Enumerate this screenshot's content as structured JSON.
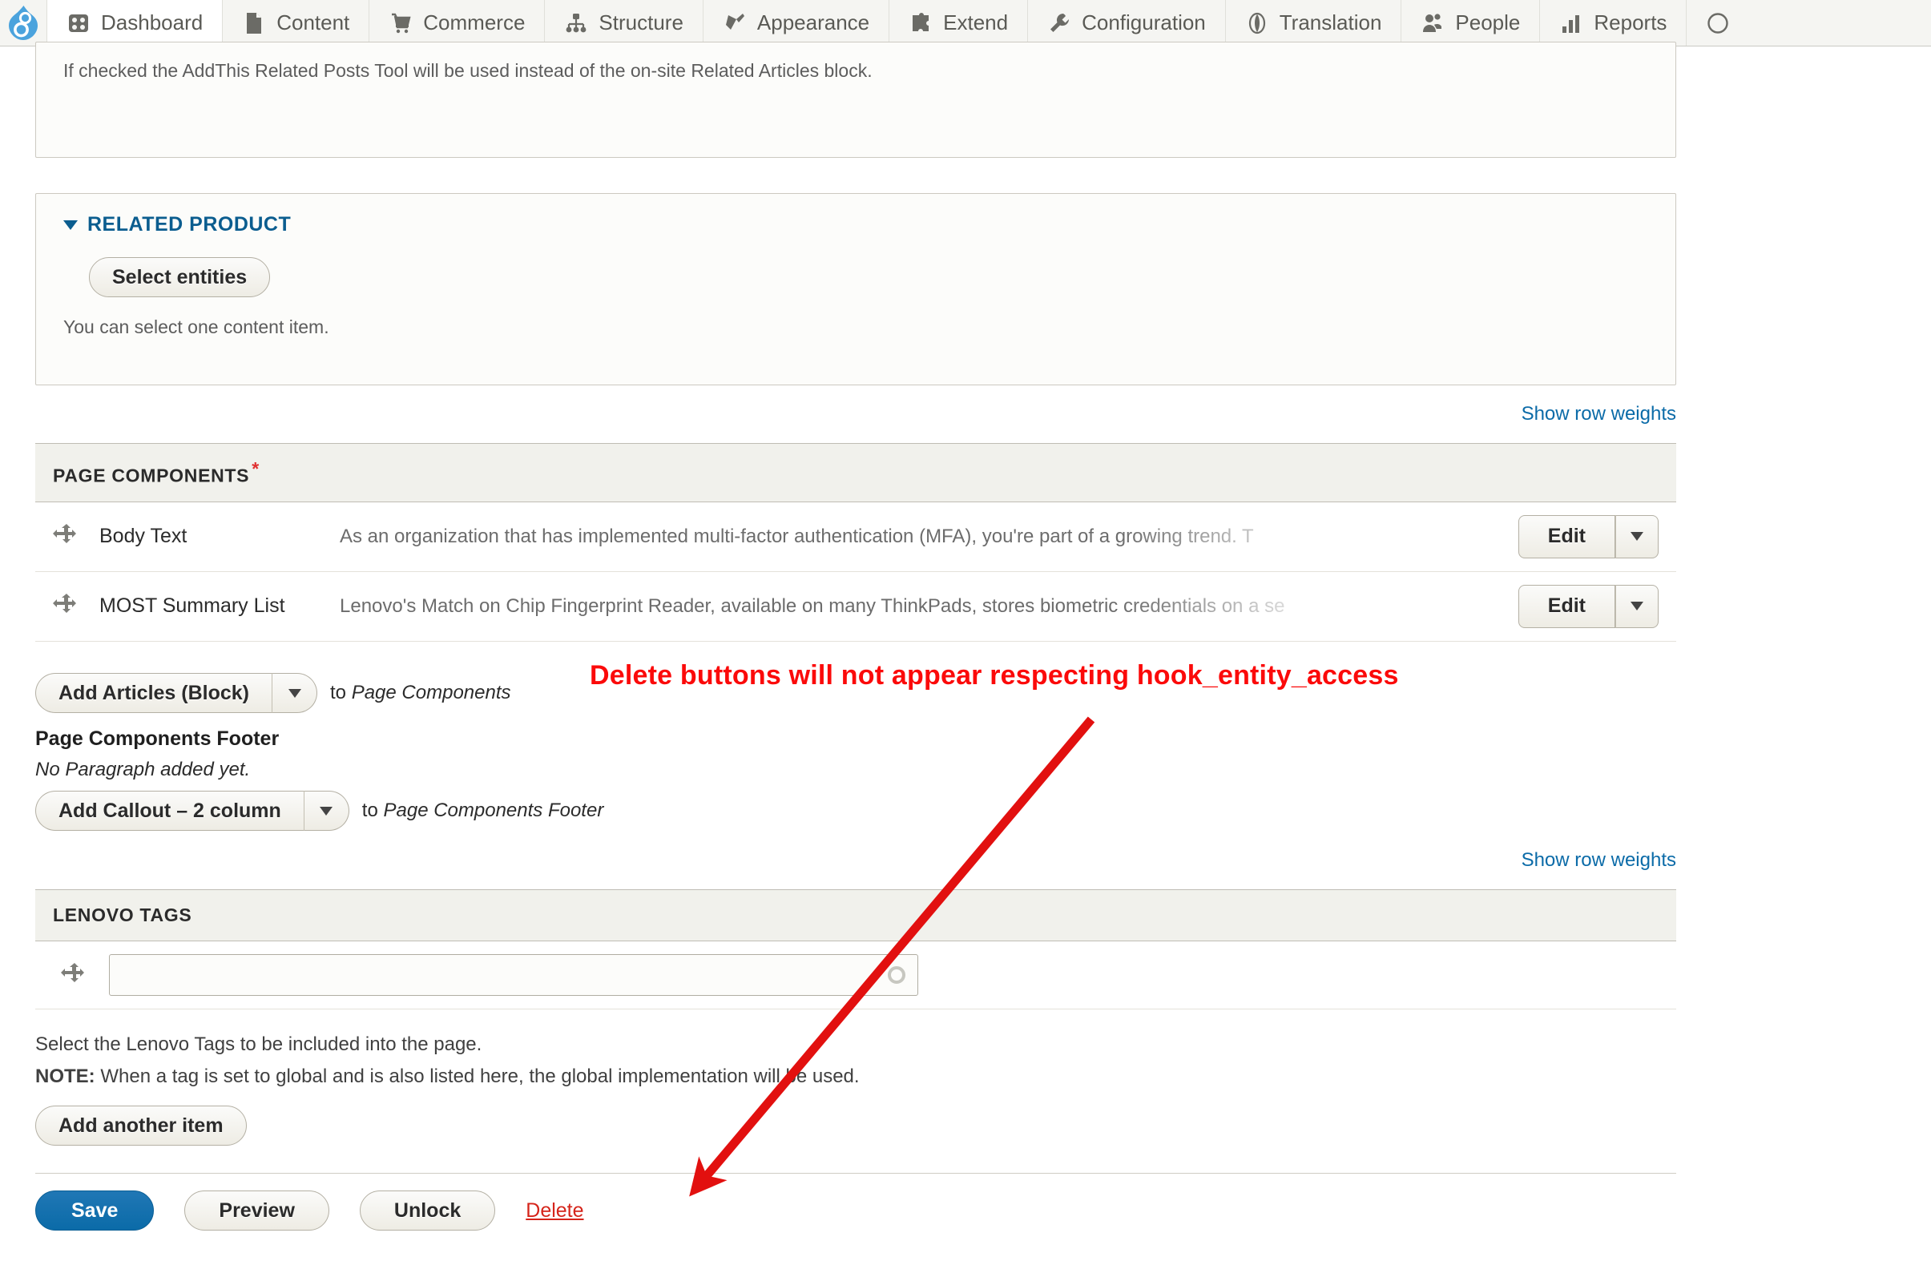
{
  "toolbar": {
    "logo_name": "drupal-logo",
    "items": [
      {
        "label": "Dashboard",
        "icon": "dashboard-icon",
        "active": true
      },
      {
        "label": "Content",
        "icon": "content-icon",
        "active": false
      },
      {
        "label": "Commerce",
        "icon": "commerce-cart-icon",
        "active": false
      },
      {
        "label": "Structure",
        "icon": "structure-icon",
        "active": false
      },
      {
        "label": "Appearance",
        "icon": "appearance-brush-icon",
        "active": false
      },
      {
        "label": "Extend",
        "icon": "extend-puzzle-icon",
        "active": false
      },
      {
        "label": "Configuration",
        "icon": "configuration-wrench-icon",
        "active": false
      },
      {
        "label": "Translation",
        "icon": "translation-globe-icon",
        "active": false
      },
      {
        "label": "People",
        "icon": "people-icon",
        "active": false
      },
      {
        "label": "Reports",
        "icon": "reports-bars-icon",
        "active": false
      },
      {
        "label": "",
        "icon": "help-icon",
        "active": false
      }
    ]
  },
  "addthis": {
    "description": "If checked the AddThis Related Posts Tool will be used instead of the on-site Related Articles block."
  },
  "related_product": {
    "legend": "RELATED PRODUCT",
    "select_entities_label": "Select entities",
    "description": "You can select one content item."
  },
  "page_components": {
    "show_row_weights": "Show row weights",
    "header": "PAGE COMPONENTS",
    "required_marker": "*",
    "rows": [
      {
        "drag_icon": "drag-handle-icon",
        "label": "Body Text",
        "summary": "As an organization that has implemented multi-factor authentication (MFA), you're part of a growing trend. T",
        "edit_label": "Edit"
      },
      {
        "drag_icon": "drag-handle-icon",
        "label": "MOST Summary List",
        "summary": "Lenovo's Match on Chip Fingerprint Reader, available on many ThinkPads, stores biometric credentials on a se",
        "edit_label": "Edit"
      }
    ],
    "add_button_label": "Add Articles (Block)",
    "add_button_suffix_prefix": "to",
    "add_button_suffix_target": "Page Components"
  },
  "page_components_footer": {
    "title": "Page Components Footer",
    "empty_message": "No Paragraph added yet.",
    "add_button_label": "Add Callout – 2 column",
    "add_button_suffix_prefix": "to",
    "add_button_suffix_target": "Page Components Footer"
  },
  "lenovo_tags": {
    "show_row_weights": "Show row weights",
    "header": "LENOVO TAGS",
    "drag_icon": "drag-handle-icon",
    "input_value": "",
    "input_placeholder": "",
    "throbber_icon": "throbber-icon",
    "description": "Select the Lenovo Tags to be included into the page.",
    "note_label": "NOTE:",
    "note_text": " When a tag is set to global and is also listed here, the global implementation will be used.",
    "add_another_label": "Add another item"
  },
  "form_actions": {
    "save_label": "Save",
    "preview_label": "Preview",
    "unlock_label": "Unlock",
    "delete_label": "Delete"
  },
  "annotation": {
    "text": "Delete buttons will not appear respecting hook_entity_access",
    "color": "#fb0a0a",
    "arrow_name": "annotation-arrow"
  },
  "colors": {
    "drupal_blue": "#4ba3dd",
    "link_blue": "#0b6ba8",
    "legend_blue": "#0b5d8f",
    "annotation_red": "#fb0a0a",
    "delete_red": "#d5241a",
    "required_red": "#e02f2f",
    "toolbar_bg": "#f5f5f2"
  }
}
